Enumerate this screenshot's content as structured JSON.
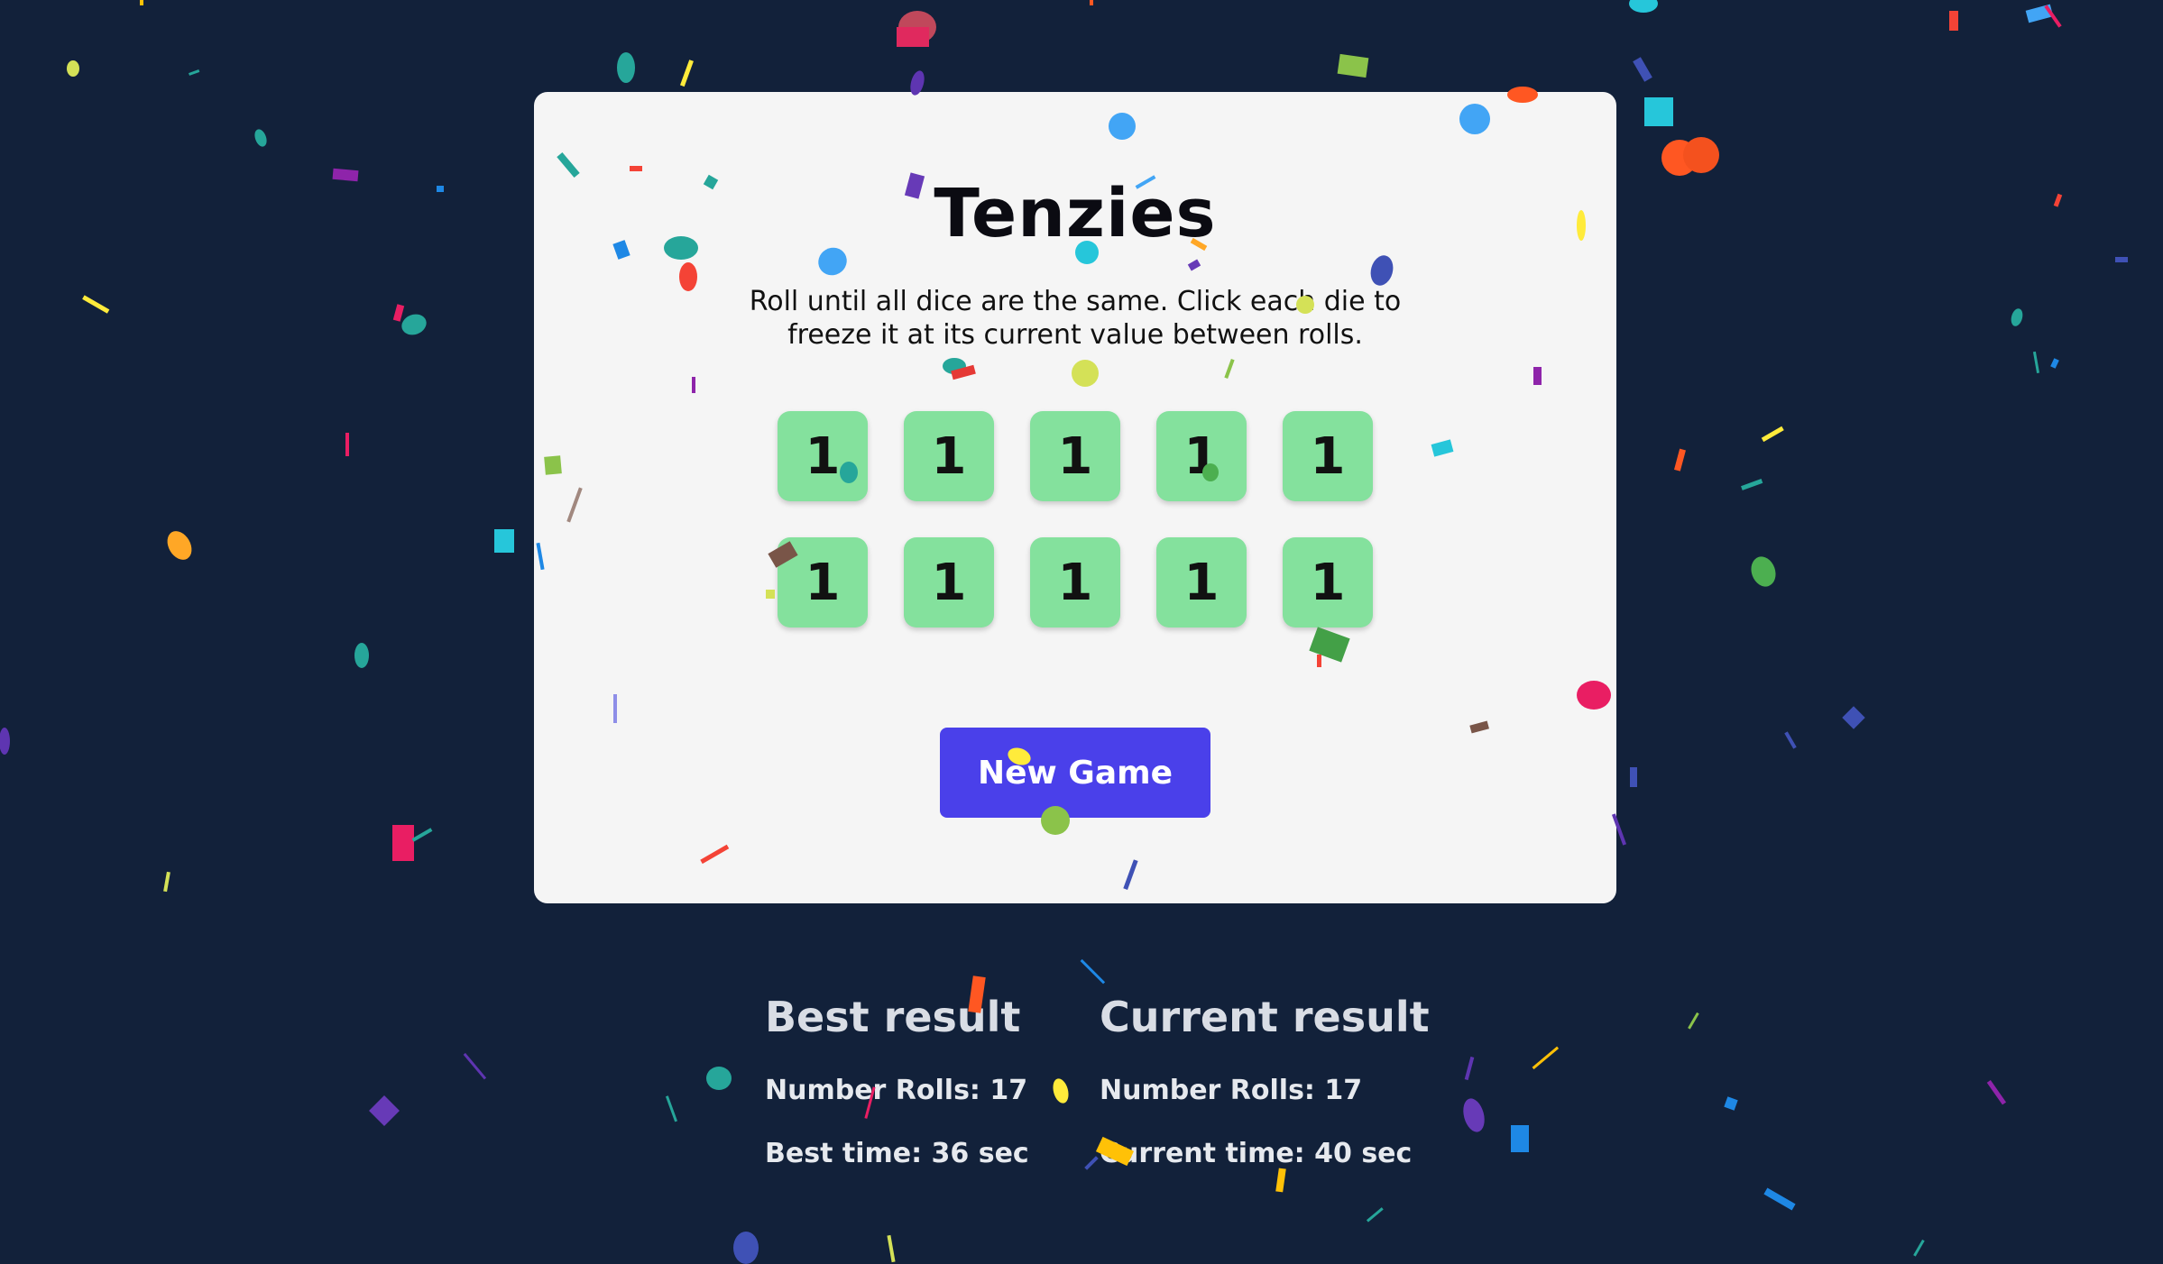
{
  "game": {
    "title": "Tenzies",
    "instructions": "Roll until all dice are the same. Click each die to freeze it at its current value between rolls.",
    "dice": [
      "1",
      "1",
      "1",
      "1",
      "1",
      "1",
      "1",
      "1",
      "1",
      "1"
    ],
    "new_game_label": "New Game"
  },
  "results": {
    "best": {
      "heading": "Best result",
      "rolls": "Number Rolls: 17",
      "time": "Best time: 36 sec"
    },
    "current": {
      "heading": "Current result",
      "rolls": "Number Rolls: 17",
      "time": "Current time: 40 sec"
    }
  },
  "colors": {
    "background": "#12213a",
    "card": "#f5f5f5",
    "die_held": "#84e19d",
    "button": "#4a40ea"
  }
}
